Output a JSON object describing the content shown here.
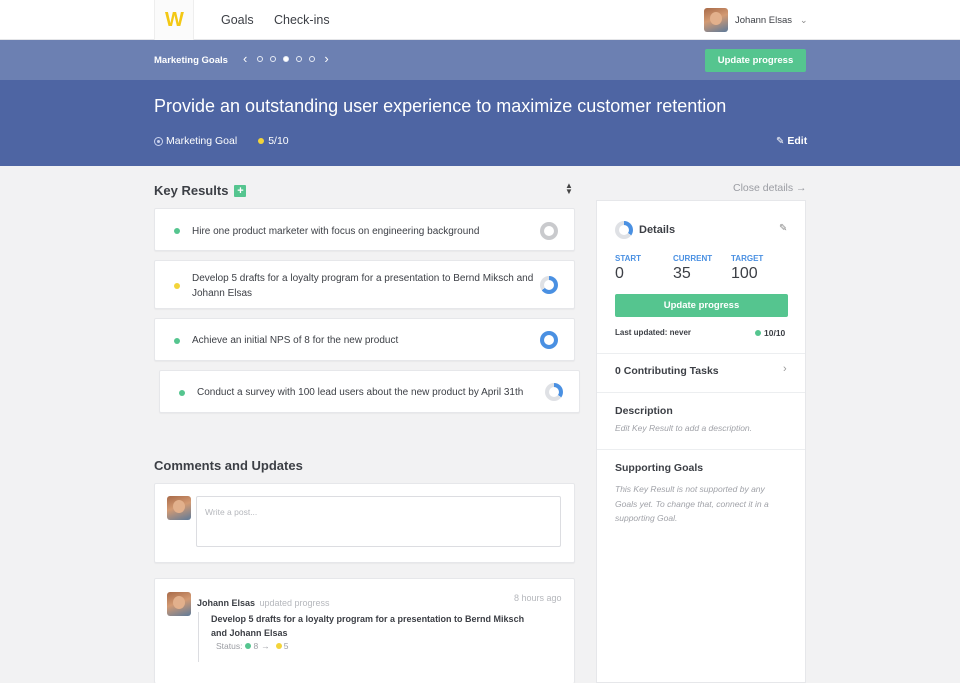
{
  "app": {
    "logo": "W"
  },
  "nav": {
    "items": [
      {
        "label": "Goals"
      },
      {
        "label": "Check-ins"
      }
    ]
  },
  "user": {
    "name": "Johann Elsas"
  },
  "subbar": {
    "breadcrumb": "Marketing Goals",
    "update_button": "Update progress",
    "pager_pages": 5,
    "pager_active": 3
  },
  "goal": {
    "title": "Provide an outstanding user experience to maximize customer retention",
    "type": "Marketing Goal",
    "score": "5/10",
    "edit_label": "Edit"
  },
  "key_results": {
    "heading": "Key Results",
    "close_details": "Close details →",
    "items": [
      {
        "text": "Hire one product marketer with focus on engineering background",
        "status_color": "#55c58f",
        "progress": 0.0,
        "ring_color": "#c9cacd"
      },
      {
        "text": "Develop 5 drafts for a loyalty program for a presentation to Bernd Miksch and Johann Elsas",
        "status_color": "#f3d43a",
        "progress": 0.65,
        "ring_color": "#4a90e2"
      },
      {
        "text": "Achieve an initial NPS of 8 for the new product",
        "status_color": "#55c58f",
        "progress": 1.0,
        "ring_color": "#4a90e2"
      },
      {
        "text": "Conduct a survey with 100 lead users about the new product by April 31th",
        "status_color": "#55c58f",
        "progress": 0.35,
        "ring_color": "#4a90e2"
      }
    ]
  },
  "comments": {
    "heading": "Comments and Updates",
    "placeholder": "Write a post...",
    "updates": [
      {
        "author": "Johann Elsas",
        "verb": "updated progress",
        "time": "8 hours ago",
        "title": "Develop 5 drafts for a loyalty program for a presentation to Bernd Miksch and Johann Elsas",
        "status_label": "Status:",
        "from": "8",
        "arrow": "→",
        "to": "5"
      }
    ]
  },
  "details": {
    "heading": "Details",
    "start_label": "START",
    "start": "0",
    "current_label": "CURRENT",
    "current": "35",
    "target_label": "TARGET",
    "target": "100",
    "update_button": "Update progress",
    "last_updated": "Last updated: never",
    "score": "10/10",
    "tasks": "0 Contributing Tasks",
    "description_title": "Description",
    "description_text": "Edit Key Result to add a description.",
    "supporting_title": "Supporting Goals",
    "supporting_text": "This Key Result is not supported by any Goals yet. To change that, connect it in a supporting Goal."
  },
  "colors": {
    "hero": "#4e65a3",
    "subbar": "#6c80b2",
    "green": "#55c58f",
    "yellow": "#f3d43a",
    "blue": "#4a90e2"
  }
}
